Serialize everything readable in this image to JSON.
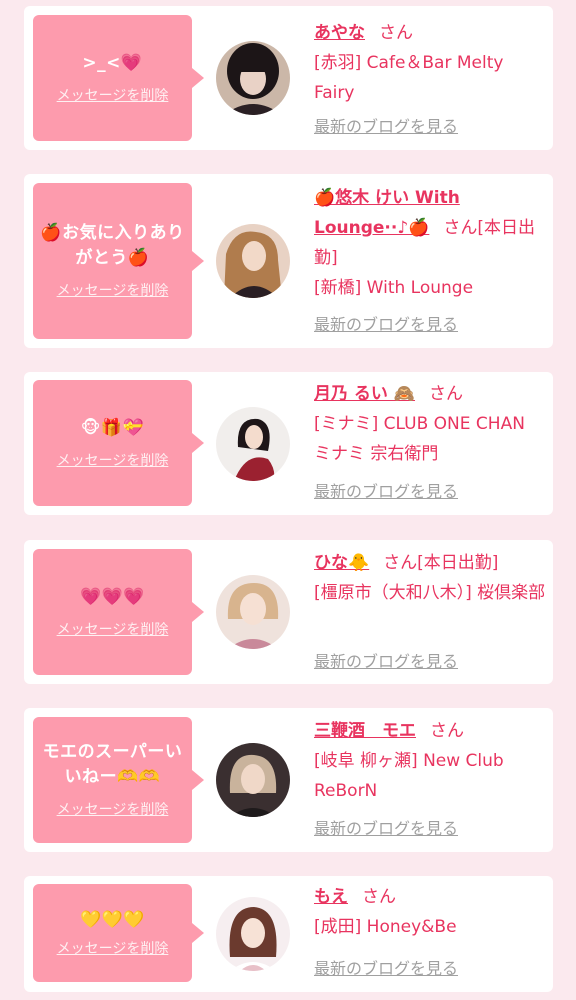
{
  "common": {
    "delete_label": "メッセージを削除",
    "san": "さん",
    "blog_label": "最新のブログを見る"
  },
  "items": [
    {
      "message": ">_<💗",
      "name": "あやな",
      "extra": "",
      "shop": "[赤羽] Cafe＆Bar Melty Fairy"
    },
    {
      "message": "🍎お気に入りありがとう🍎",
      "name": "🍎悠木 けい With Lounge··♪🍎",
      "extra": "[本日出勤]",
      "shop": "[新橋] With Lounge"
    },
    {
      "message": "🐵🎁💝",
      "name": "月乃 るい 🙈",
      "extra": "",
      "shop": "[ミナミ] CLUB ONE CHAN ミナミ 宗右衛門"
    },
    {
      "message": "💗💗💗",
      "name": "ひな🐥",
      "extra": "[本日出勤]",
      "shop": "[橿原市（大和八木）] 桜倶楽部"
    },
    {
      "message": "モエのスーパーいいねー🫶🫶",
      "name": "三鞭酒　モエ",
      "extra": "",
      "shop": "[岐阜 柳ヶ瀬] New Club ReBorN"
    },
    {
      "message": "💛💛💛",
      "name": "もえ",
      "extra": "",
      "shop": "[成田] Honey&Be"
    }
  ]
}
